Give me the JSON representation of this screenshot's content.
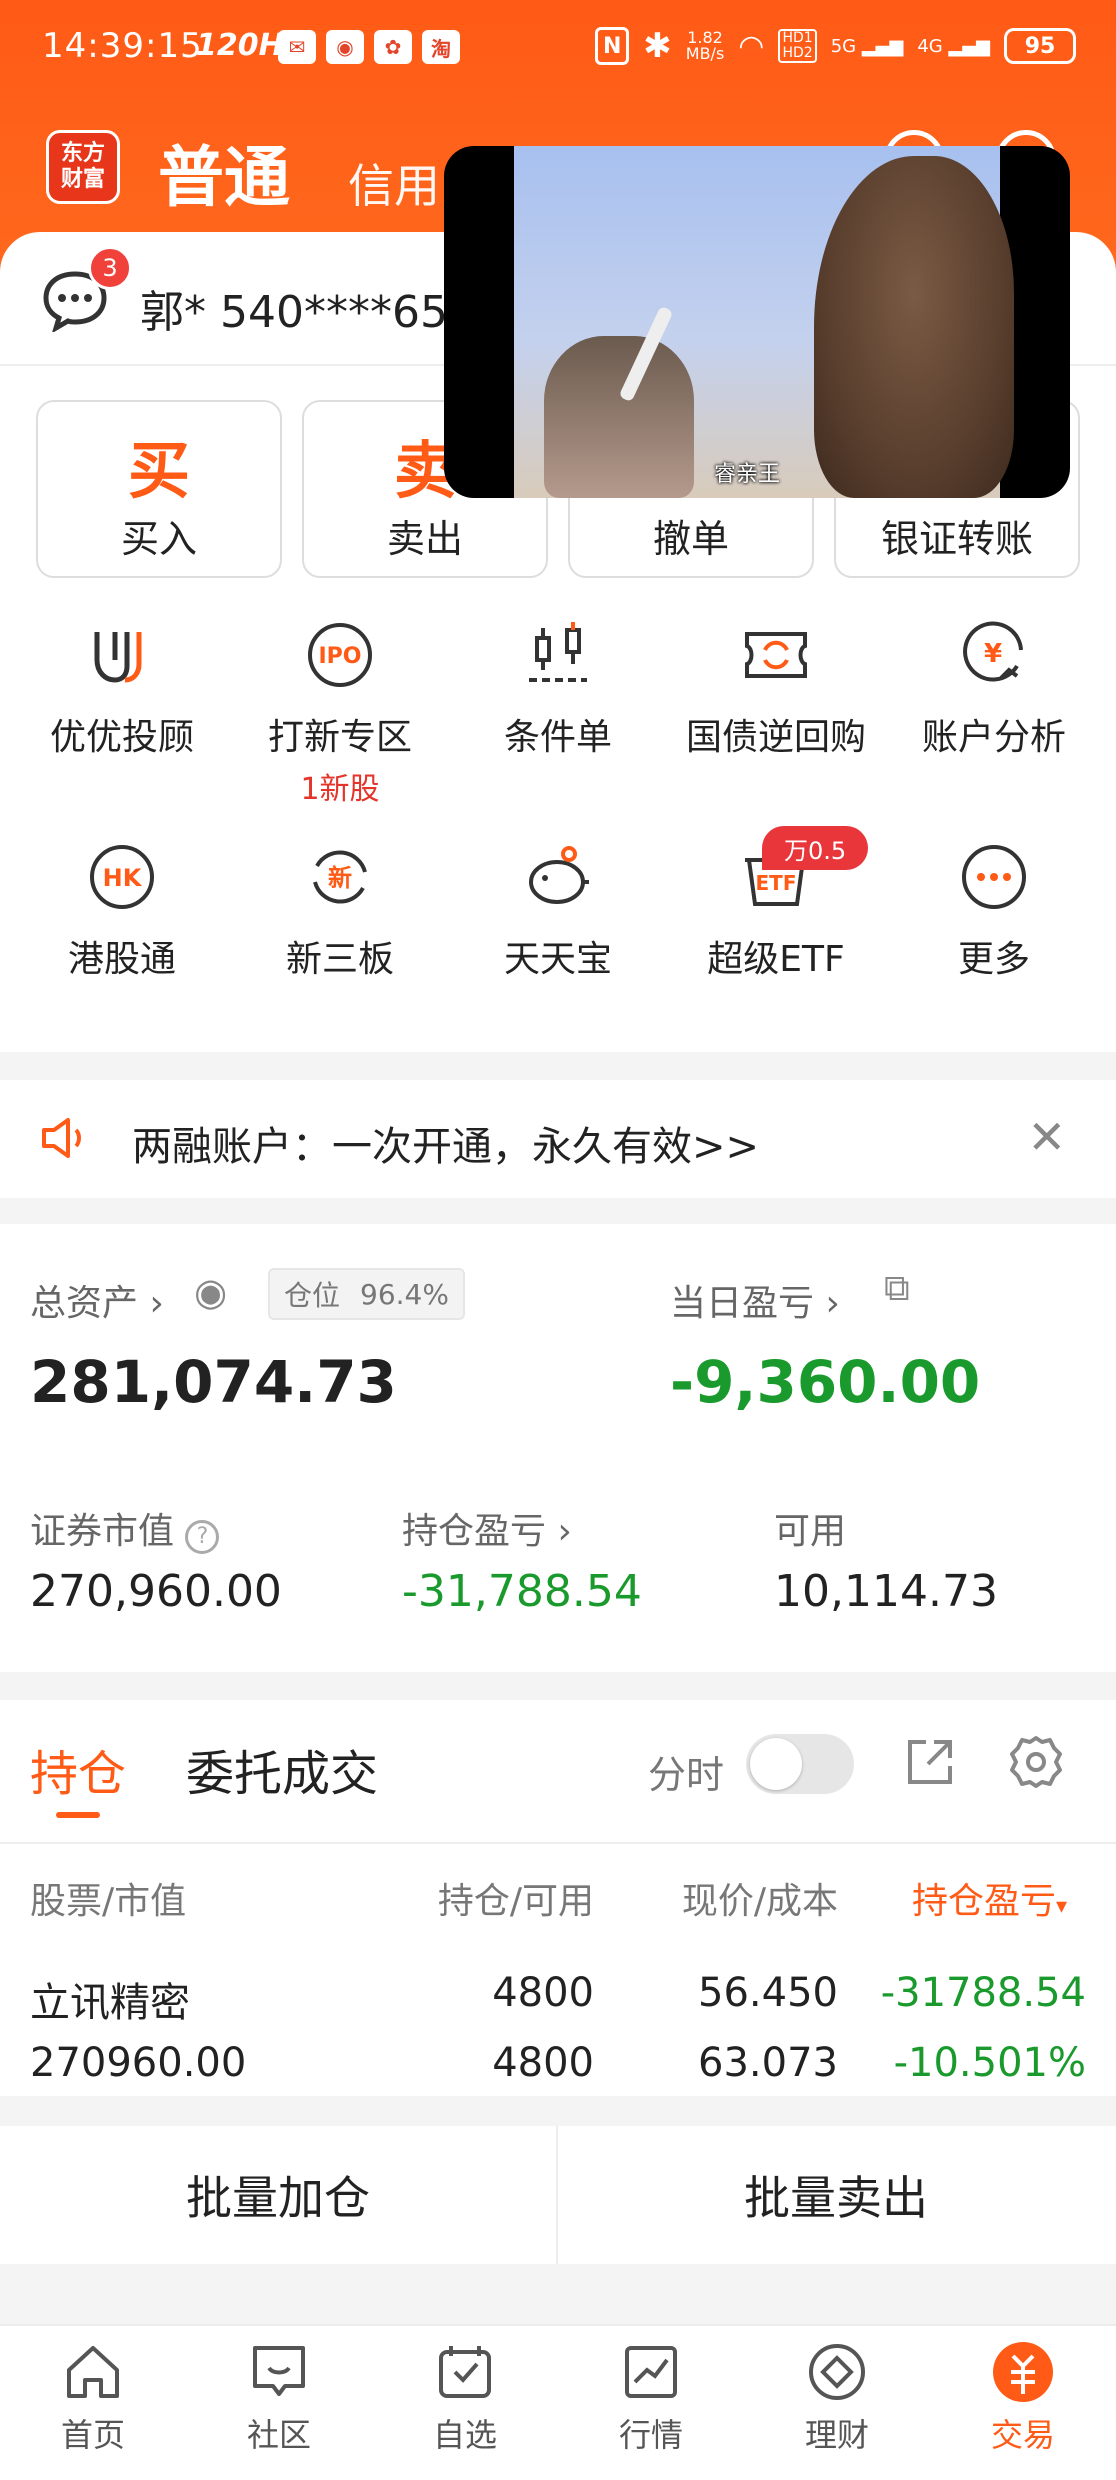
{
  "statusbar": {
    "time": "14:39:15",
    "refresh": "120Hz",
    "net_speed_value": "1.82",
    "net_speed_unit": "MB/s",
    "hd1": "HD1",
    "hd2": "HD2",
    "sig1": "5G",
    "sig2": "4G",
    "battery": "95"
  },
  "header": {
    "logo_line1": "东方",
    "logo_line2": "财富",
    "tab_normal": "普通",
    "tab_credit": "信用"
  },
  "account": {
    "message_badge": "3",
    "name": "郭* 540****65"
  },
  "quick_actions": [
    {
      "big": "买",
      "label": "买入"
    },
    {
      "big": "卖",
      "label": "卖出"
    },
    {
      "big": "",
      "label": "撤单"
    },
    {
      "big": "",
      "label": "银证转账"
    }
  ],
  "features_row1": [
    {
      "label": "优优投顾",
      "icon": "advisor-icon"
    },
    {
      "label": "打新专区",
      "sub": "1新股",
      "icon": "ipo-icon"
    },
    {
      "label": "条件单",
      "icon": "conditional-order-icon"
    },
    {
      "label": "国债逆回购",
      "icon": "reverse-repo-icon"
    },
    {
      "label": "账户分析",
      "icon": "account-analysis-icon"
    }
  ],
  "features_row2": [
    {
      "label": "港股通",
      "icon": "hk-icon"
    },
    {
      "label": "新三板",
      "icon": "neeq-icon"
    },
    {
      "label": "天天宝",
      "icon": "piggy-bank-icon"
    },
    {
      "label": "超级ETF",
      "icon": "etf-icon"
    },
    {
      "label": "更多",
      "icon": "more-icon"
    }
  ],
  "etf_badge": "万0.5",
  "notice": {
    "text": "两融账户：一次开通，永久有效>>"
  },
  "assets": {
    "total_label": "总资产",
    "position_label": "仓位",
    "position_value": "96.4%",
    "total_value": "281,074.73",
    "daily_pnl_label": "当日盈亏",
    "daily_pnl_value": "-9,360.00",
    "market_value_label": "证券市值",
    "market_value": "270,960.00",
    "holding_pnl_label": "持仓盈亏",
    "holding_pnl_value": "-31,788.54",
    "available_label": "可用",
    "available_value": "10,114.73",
    "negative_color": "#1a9a2c"
  },
  "holdings": {
    "tab_positions": "持仓",
    "tab_orders": "委托成交",
    "intraday_label": "分时",
    "columns": [
      "股票/市值",
      "持仓/可用",
      "现价/成本",
      "持仓盈亏"
    ],
    "rows": [
      {
        "name": "立讯精密",
        "market_value": "270960.00",
        "position": "4800",
        "available": "4800",
        "price": "56.450",
        "cost": "63.073",
        "pnl": "-31788.54",
        "pnl_pct": "-10.501%"
      }
    ]
  },
  "batch": {
    "add": "批量加仓",
    "sell": "批量卖出"
  },
  "nav": [
    {
      "label": "首页",
      "icon": "home-icon"
    },
    {
      "label": "社区",
      "icon": "community-icon"
    },
    {
      "label": "自选",
      "icon": "watchlist-icon"
    },
    {
      "label": "行情",
      "icon": "market-icon"
    },
    {
      "label": "理财",
      "icon": "wealth-icon"
    },
    {
      "label": "交易",
      "icon": "trade-icon",
      "active": true
    }
  ],
  "video": {
    "subtitle": "睿亲王"
  },
  "brand_color": "#ff5a16"
}
